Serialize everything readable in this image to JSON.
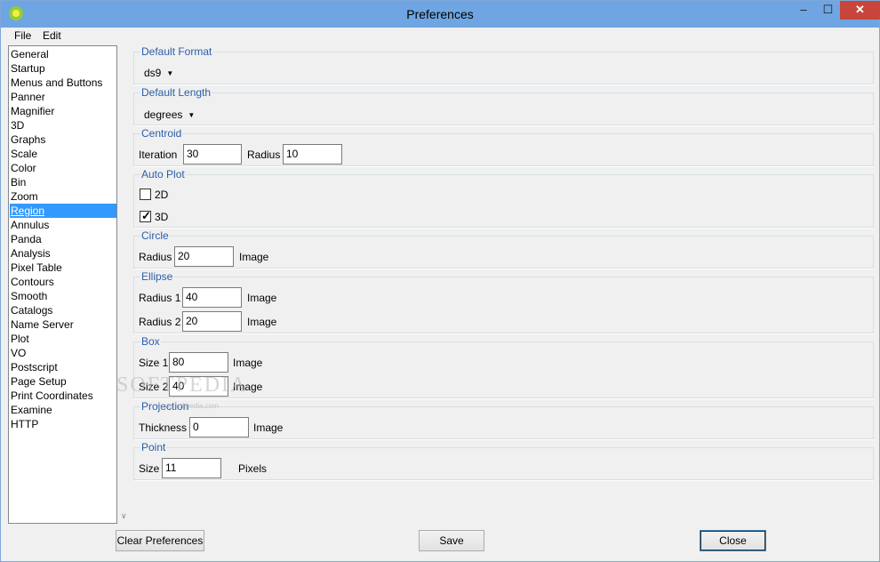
{
  "window": {
    "title": "Preferences",
    "controls": {
      "minimize": "–",
      "maximize": "☐",
      "close": "✕"
    }
  },
  "menu": [
    "File",
    "Edit"
  ],
  "sidebar": {
    "selected": "Region",
    "items": [
      "General",
      "Startup",
      "Menus and Buttons",
      "Panner",
      "Magnifier",
      "3D",
      "Graphs",
      "Scale",
      "Color",
      "Bin",
      "Zoom",
      "Region",
      "Annulus",
      "Panda",
      "Analysis",
      "Pixel Table",
      "Contours",
      "Smooth",
      "Catalogs",
      "Name Server",
      "Plot",
      "VO",
      "Postscript",
      "Page Setup",
      "Print Coordinates",
      "Examine",
      "HTTP"
    ]
  },
  "sections": {
    "default_format": {
      "title": "Default Format",
      "value": "ds9"
    },
    "default_length": {
      "title": "Default Length",
      "value": "degrees"
    },
    "centroid": {
      "title": "Centroid",
      "iteration_label": "Iteration",
      "iteration": "30",
      "radius_label": "Radius",
      "radius": "10"
    },
    "auto_plot": {
      "title": "Auto Plot",
      "opt_2d": "2D",
      "checked_2d": false,
      "opt_3d": "3D",
      "checked_3d": true
    },
    "circle": {
      "title": "Circle",
      "radius_label": "Radius",
      "radius": "20",
      "unit": "Image"
    },
    "ellipse": {
      "title": "Ellipse",
      "radius1_label": "Radius 1",
      "radius1": "40",
      "radius2_label": "Radius 2",
      "radius2": "20",
      "unit": "Image"
    },
    "box": {
      "title": "Box",
      "size1_label": "Size 1",
      "size1": "80",
      "size2_label": "Size 2",
      "size2": "40",
      "unit": "Image"
    },
    "projection": {
      "title": "Projection",
      "thickness_label": "Thickness",
      "thickness": "0",
      "unit": "Image"
    },
    "point": {
      "title": "Point",
      "size_label": "Size",
      "size": "11",
      "unit": "Pixels"
    }
  },
  "buttons": {
    "clear": "Clear Preferences",
    "save": "Save",
    "close": "Close"
  },
  "watermark": {
    "text": "SOFTPEDIA",
    "sub": "www.softpedia.com"
  },
  "colors": {
    "titlebar": "#6ea5e2",
    "selection": "#3399ff",
    "group_title": "#2b5ea8",
    "close_button": "#c7453b"
  }
}
